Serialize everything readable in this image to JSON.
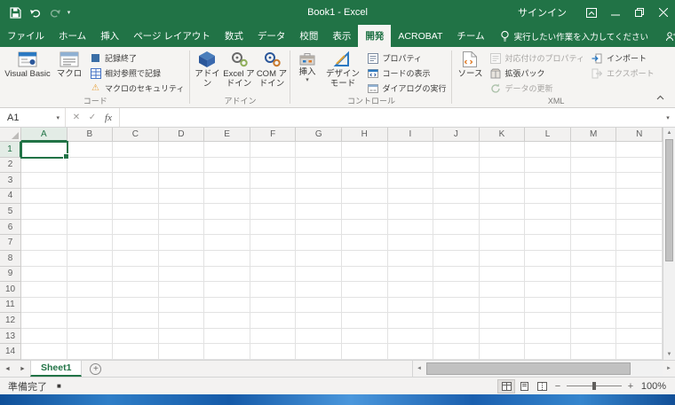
{
  "titlebar": {
    "title": "Book1 - Excel",
    "signin": "サインイン"
  },
  "ribbon_tabs": {
    "file": "ファイル",
    "items": [
      {
        "label": "ホーム",
        "active": false
      },
      {
        "label": "挿入",
        "active": false
      },
      {
        "label": "ページ レイアウト",
        "active": false
      },
      {
        "label": "数式",
        "active": false
      },
      {
        "label": "データ",
        "active": false
      },
      {
        "label": "校閲",
        "active": false
      },
      {
        "label": "表示",
        "active": false
      },
      {
        "label": "開発",
        "active": true
      },
      {
        "label": "ACROBAT",
        "active": false
      },
      {
        "label": "チーム",
        "active": false
      }
    ],
    "tell_me": "実行したい作業を入力してください",
    "share": "共有"
  },
  "ribbon": {
    "code": {
      "label": "コード",
      "visual_basic": "Visual Basic",
      "macros": "マクロ",
      "stop_recording": "記録終了",
      "relative_references": "相対参照で記録",
      "macro_security": "マクロのセキュリティ"
    },
    "addins": {
      "label": "アドイン",
      "addins": "アドイン",
      "excel_addins": "Excel アドイン",
      "com_addins": "COM アドイン"
    },
    "controls": {
      "label": "コントロール",
      "insert": "挿入",
      "design_mode": "デザイン モード",
      "properties": "プロパティ",
      "view_code": "コードの表示",
      "run_dialog": "ダイアログの実行"
    },
    "xml": {
      "label": "XML",
      "source": "ソース",
      "map_properties": "対応付けのプロパティ",
      "expansion_packs": "拡張パック",
      "refresh_data": "データの更新",
      "import": "インポート",
      "export": "エクスポート"
    }
  },
  "formula_bar": {
    "name_box": "A1",
    "formula": ""
  },
  "grid": {
    "columns": [
      "A",
      "B",
      "C",
      "D",
      "E",
      "F",
      "G",
      "H",
      "I",
      "J",
      "K",
      "L",
      "M",
      "N"
    ],
    "rows": [
      "1",
      "2",
      "3",
      "4",
      "5",
      "6",
      "7",
      "8",
      "9",
      "10",
      "11",
      "12",
      "13",
      "14"
    ],
    "selected": {
      "col": "A",
      "row": "1"
    }
  },
  "sheet_bar": {
    "tabs": [
      {
        "label": "Sheet1",
        "active": true
      }
    ]
  },
  "status_bar": {
    "mode": "準備完了",
    "zoom": "100%"
  },
  "glyphs": {
    "dropdown": "▾",
    "check": "✓",
    "cross": "✕",
    "fx": "fx",
    "left": "◄",
    "right": "►",
    "up": "▲",
    "down": "▼",
    "plus": "+",
    "minus": "−",
    "square": "■",
    "warning": "⚠",
    "add_sheet": "+"
  },
  "colors": {
    "excel_green": "#217346",
    "ribbon_bg": "#f5f4f2",
    "grid_line": "#e2e2e2"
  }
}
